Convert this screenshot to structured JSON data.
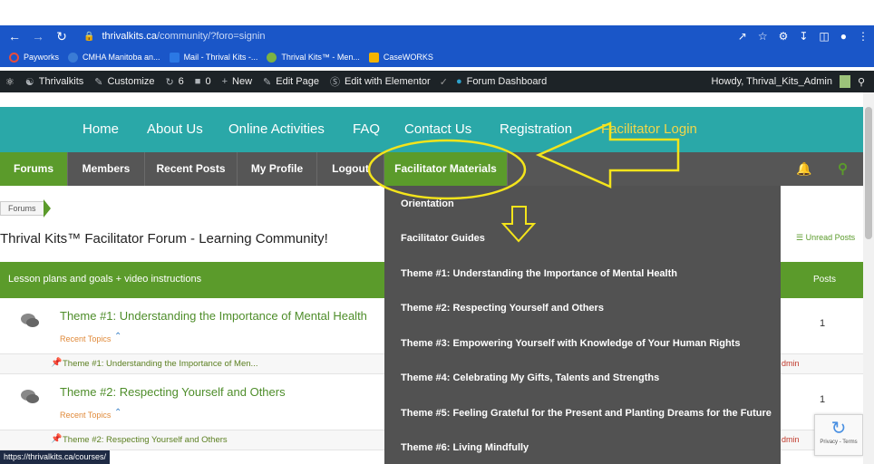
{
  "browser": {
    "url_domain": "thrivalkits.ca",
    "url_path": "/community/?foro=signin"
  },
  "bookmarks": [
    {
      "label": "Payworks",
      "color": "#e74c3c"
    },
    {
      "label": "CMHA Manitoba an...",
      "color": "#3a7bd5"
    },
    {
      "label": "Mail - Thrival Kits -...",
      "color": "#2b78e4"
    },
    {
      "label": "Thrival Kits™ - Men...",
      "color": "#7cb342"
    },
    {
      "label": "CaseWORKS",
      "color": "#f4b400"
    }
  ],
  "adminbar": {
    "site": "Thrivalkits",
    "customize": "Customize",
    "updates": "6",
    "comments": "0",
    "new": "New",
    "edit_page": "Edit Page",
    "elementor": "Edit with Elementor",
    "forum_dashboard": "Forum Dashboard",
    "howdy": "Howdy, Thrival_Kits_Admin"
  },
  "main_nav": [
    {
      "label": "Home",
      "color": "#ffffff"
    },
    {
      "label": "About Us",
      "color": "#ffffff"
    },
    {
      "label": "Online Activities",
      "color": "#ffffff"
    },
    {
      "label": "FAQ",
      "color": "#ffffff"
    },
    {
      "label": "Contact Us",
      "color": "#ffffff"
    },
    {
      "label": "Registration",
      "color": "#ffffff"
    },
    {
      "label": "Facilitator Login",
      "color": "#f1d64a"
    }
  ],
  "forum_nav": [
    {
      "label": "Forums"
    },
    {
      "label": "Members"
    },
    {
      "label": "Recent Posts"
    },
    {
      "label": "My Profile"
    },
    {
      "label": "Logout"
    },
    {
      "label": "Facilitator Materials"
    }
  ],
  "breadcrumb": "Forums",
  "page_title": "Thrival Kits™ Facilitator Forum - Learning Community!",
  "unread_posts": "Unread Posts",
  "section_header": {
    "subtitle": "Lesson plans and goals + video instructions",
    "posts_label": "Posts"
  },
  "forums": [
    {
      "name": "Theme #1: Understanding the Importance of Mental Health",
      "recent_label": "Recent Topics",
      "count": "1",
      "topic": "Theme #1: Understanding the Importance of Men...",
      "topic_author": "dmin"
    },
    {
      "name": "Theme #2: Respecting Yourself and Others",
      "recent_label": "Recent Topics",
      "count": "1",
      "topic": "Theme #2: Respecting Yourself and Others",
      "topic_author": "dmin"
    }
  ],
  "dropdown": [
    "Orientation",
    "Facilitator Guides",
    "Theme #1: Understanding the Importance of Mental Health",
    "Theme #2: Respecting Yourself and Others",
    "Theme #3: Empowering Yourself with Knowledge of Your Human Rights",
    "Theme #4: Celebrating My Gifts, Talents and Strengths",
    "Theme #5: Feeling Grateful for the Present and Planting Dreams for the Future",
    "Theme #6: Living Mindfully"
  ],
  "status_url": "https://thrivalkits.ca/courses/",
  "recaptcha": "Privacy - Terms",
  "icons": {
    "back": "back-arrow-icon",
    "forward": "forward-arrow-icon",
    "reload": "reload-icon",
    "lock": "lock-icon"
  }
}
